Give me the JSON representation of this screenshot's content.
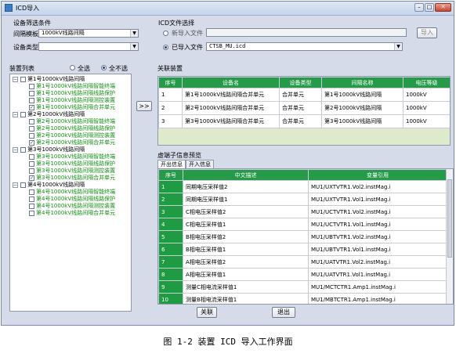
{
  "window": {
    "title": "ICD导入"
  },
  "device_filter": {
    "group_label": "设备筛选条件",
    "bay_template_label": "间隔模板",
    "bay_template_value": "1000kV线路间隔",
    "device_type_label": "设备类型",
    "device_type_value": ""
  },
  "icd_select": {
    "group_label": "ICD文件选择",
    "new_import_label": "新导入文件",
    "new_import_value": "",
    "imported_label": "已导入文件",
    "imported_value": "CTSB_MU.icd",
    "import_button": "导入"
  },
  "device_list": {
    "label": "装置列表",
    "select_all": "全选",
    "select_none": "全不选",
    "tree": [
      {
        "label": "第1号1000kV线路间隔",
        "children": [
          {
            "label": "第1号1000kV线路间隔智能终端",
            "checked": false
          },
          {
            "label": "第1号1000kV线路间隔线路保护",
            "checked": false
          },
          {
            "label": "第1号1000kV线路间隔测控装置",
            "checked": false
          },
          {
            "label": "第1号1000kV线路间隔合并单元",
            "checked": true
          }
        ]
      },
      {
        "label": "第2号1000kV线路间隔",
        "children": [
          {
            "label": "第2号1000kV线路间隔智能终端",
            "checked": false
          },
          {
            "label": "第2号1000kV线路间隔线路保护",
            "checked": false
          },
          {
            "label": "第2号1000kV线路间隔测控装置",
            "checked": false
          },
          {
            "label": "第2号1000kV线路间隔合并单元",
            "checked": true
          }
        ]
      },
      {
        "label": "第3号1000kV线路间隔",
        "children": [
          {
            "label": "第3号1000kV线路间隔智能终端",
            "checked": false
          },
          {
            "label": "第3号1000kV线路间隔线路保护",
            "checked": false
          },
          {
            "label": "第3号1000kV线路间隔测控装置",
            "checked": false
          },
          {
            "label": "第3号1000kV线路间隔合并单元",
            "checked": true
          }
        ]
      },
      {
        "label": "第4号1000kV线路间隔",
        "children": [
          {
            "label": "第4号1000kV线路间隔智能终端",
            "checked": false
          },
          {
            "label": "第4号1000kV线路间隔线路保护",
            "checked": false
          },
          {
            "label": "第4号1000kV线路间隔测控装置",
            "checked": false
          },
          {
            "label": "第4号1000kV线路间隔合并单元",
            "checked": false
          }
        ]
      }
    ]
  },
  "move_button": ">>",
  "related_devices": {
    "label": "关联装置",
    "columns": [
      "序号",
      "设备名",
      "设备类型",
      "间隔名称",
      "电压等级"
    ],
    "rows": [
      [
        "1",
        "第1号1000kV线路间隔合并单元",
        "合并单元",
        "第1号1000kV线路间隔",
        "1000kV"
      ],
      [
        "2",
        "第2号1000kV线路间隔合并单元",
        "合并单元",
        "第2号1000kV线路间隔",
        "1000kV"
      ],
      [
        "3",
        "第3号1000kV线路间隔合并单元",
        "合并单元",
        "第3号1000kV线路间隔",
        "1000kV"
      ]
    ]
  },
  "terminal_preview": {
    "label": "虚端子信息预览",
    "tabs": [
      "开出信息",
      "开入信息"
    ],
    "columns": [
      "序号",
      "中文描述",
      "变量引用"
    ],
    "rows": [
      [
        "1",
        "同期电压采样值2",
        "MU1/UXTVTR1.Vol2.instMag.i"
      ],
      [
        "2",
        "同期电压采样值1",
        "MU1/UXTVTR1.Vol1.instMag.i"
      ],
      [
        "3",
        "C相电压采样值2",
        "MU1/UCTVTR1.Vol2.instMag.i"
      ],
      [
        "4",
        "C相电压采样值1",
        "MU1/UCTVTR1.Vol1.instMag.i"
      ],
      [
        "5",
        "B相电压采样值2",
        "MU1/UBTVTR1.Vol2.instMag.i"
      ],
      [
        "6",
        "B相电压采样值1",
        "MU1/UBTVTR1.Vol1.instMag.i"
      ],
      [
        "7",
        "A相电压采样值2",
        "MU1/UATVTR1.Vol2.instMag.i"
      ],
      [
        "8",
        "A相电压采样值1",
        "MU1/UATVTR1.Vol1.instMag.i"
      ],
      [
        "9",
        "测量C相电流采样值1",
        "MU1/MCTCTR1.Amp1.instMag.i"
      ],
      [
        "10",
        "测量B相电流采样值1",
        "MU1/MBTCTR1.Amp1.instMag.i"
      ]
    ]
  },
  "footer": {
    "link_button": "关联",
    "exit_button": "退出"
  },
  "caption": "图 1-2 装置 ICD 导入工作界面",
  "colors": {
    "table_header": "#259a48",
    "row_number": "#1f9b44",
    "tree_child": "#159015"
  }
}
